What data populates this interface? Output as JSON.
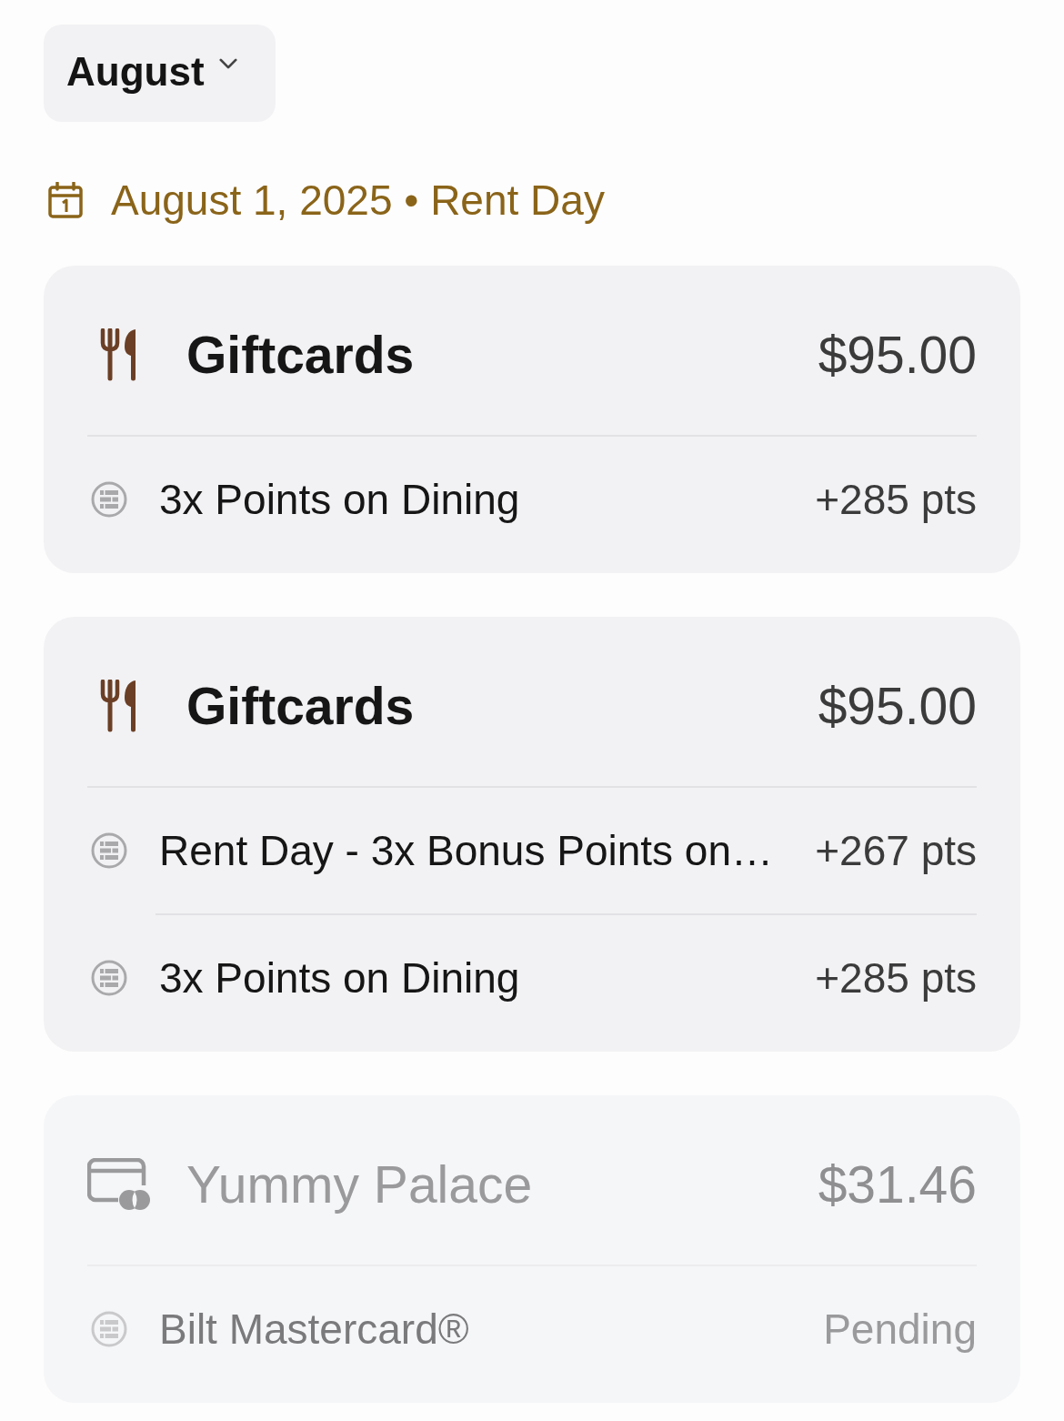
{
  "month_selector": {
    "label": "August"
  },
  "date_header": {
    "text": "August 1, 2025 • Rent Day"
  },
  "transactions": [
    {
      "kind": "dining",
      "merchant": "Giftcards",
      "amount": "$95.00",
      "pending": false,
      "rewards": [
        {
          "label": "3x Points on Dining",
          "value": "+285 pts"
        }
      ]
    },
    {
      "kind": "dining",
      "merchant": "Giftcards",
      "amount": "$95.00",
      "pending": false,
      "rewards": [
        {
          "label": "Rent Day - 3x Bonus Points on…",
          "value": "+267 pts"
        },
        {
          "label": "3x Points on Dining",
          "value": "+285 pts"
        }
      ]
    },
    {
      "kind": "card",
      "merchant": "Yummy Palace",
      "amount": "$31.46",
      "pending": true,
      "rewards": [
        {
          "label": "Bilt Mastercard®",
          "value": "Pending"
        }
      ]
    }
  ]
}
